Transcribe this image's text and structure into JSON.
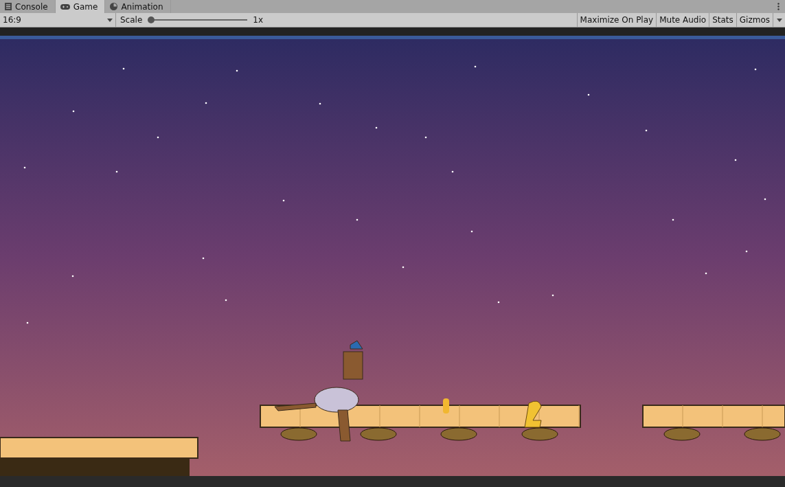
{
  "tabs": [
    {
      "label": "Console",
      "selected": false
    },
    {
      "label": "Game",
      "selected": true
    },
    {
      "label": "Animation",
      "selected": false
    }
  ],
  "toolbar": {
    "aspect": "16:9",
    "scale": {
      "label": "Scale",
      "level": 0,
      "reading": "1x"
    },
    "toggles": [
      {
        "label": "Maximize On Play",
        "on": false
      },
      {
        "label": "Mute Audio",
        "on": false
      },
      {
        "label": "Stats",
        "on": false
      },
      {
        "label": "Gizmos",
        "on": false
      }
    ]
  }
}
